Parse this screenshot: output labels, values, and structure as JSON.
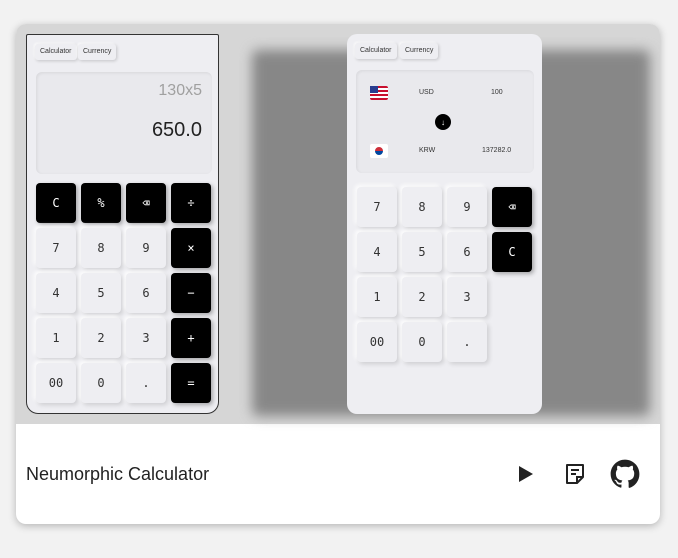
{
  "project": {
    "title": "Neumorphic Calculator"
  },
  "phone_left": {
    "tabs": [
      "Calculator",
      "Currency"
    ],
    "expression": "130x5",
    "result": "650.0",
    "keys": [
      {
        "label": "C",
        "dark": true
      },
      {
        "label": "%",
        "dark": true
      },
      {
        "label": "⌫",
        "dark": true
      },
      {
        "label": "÷",
        "dark": true
      },
      {
        "label": "7",
        "dark": false
      },
      {
        "label": "8",
        "dark": false
      },
      {
        "label": "9",
        "dark": false
      },
      {
        "label": "×",
        "dark": true
      },
      {
        "label": "4",
        "dark": false
      },
      {
        "label": "5",
        "dark": false
      },
      {
        "label": "6",
        "dark": false
      },
      {
        "label": "−",
        "dark": true
      },
      {
        "label": "1",
        "dark": false
      },
      {
        "label": "2",
        "dark": false
      },
      {
        "label": "3",
        "dark": false
      },
      {
        "label": "+",
        "dark": true
      },
      {
        "label": "00",
        "dark": false
      },
      {
        "label": "0",
        "dark": false
      },
      {
        "label": ".",
        "dark": false
      },
      {
        "label": "=",
        "dark": true
      }
    ]
  },
  "phone_right": {
    "tabs": [
      "Calculator",
      "Currency"
    ],
    "from_currency": {
      "code": "USD",
      "amount": "100",
      "flag": "us-flag-icon"
    },
    "to_currency": {
      "code": "KRW",
      "amount": "137282.0",
      "flag": "kr-flag-icon"
    },
    "swap_glyph": "↓",
    "keys": [
      {
        "label": "7",
        "dark": false
      },
      {
        "label": "8",
        "dark": false
      },
      {
        "label": "9",
        "dark": false
      },
      {
        "label": "⌫",
        "dark": true
      },
      {
        "label": "4",
        "dark": false
      },
      {
        "label": "5",
        "dark": false
      },
      {
        "label": "6",
        "dark": false
      },
      {
        "label": "C",
        "dark": true
      },
      {
        "label": "1",
        "dark": false
      },
      {
        "label": "2",
        "dark": false
      },
      {
        "label": "3",
        "dark": false
      },
      {
        "label": "00",
        "dark": false
      },
      {
        "label": "0",
        "dark": false
      },
      {
        "label": ".",
        "dark": false
      }
    ]
  },
  "actions": [
    {
      "name": "play-icon"
    },
    {
      "name": "notes-icon"
    },
    {
      "name": "github-icon"
    }
  ],
  "colors": {
    "key_dark": "#000000",
    "surface": "#eeeef2",
    "preview_bg": "#d6d6d6"
  }
}
